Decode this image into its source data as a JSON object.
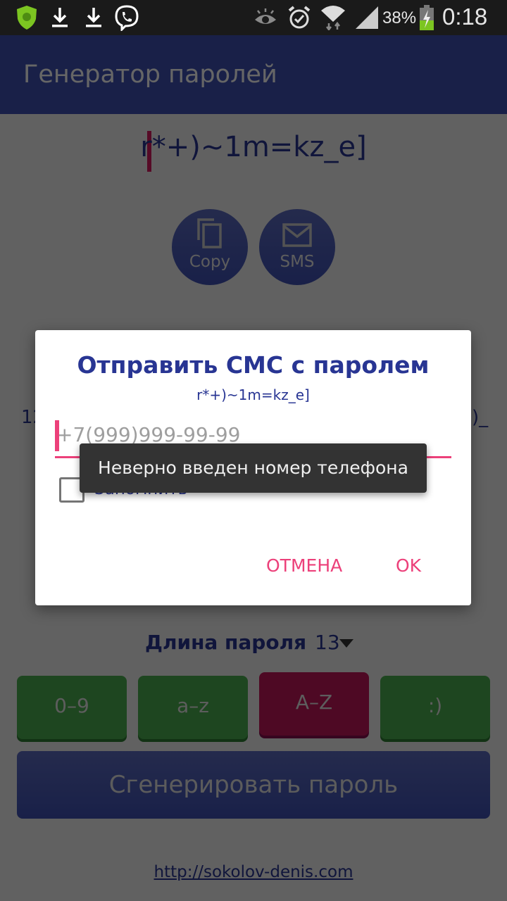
{
  "status_bar": {
    "left_icons": [
      "antivirus-shield-icon",
      "download-icon",
      "download-icon",
      "viber-icon"
    ],
    "right_icons": [
      "smart-stay-eye-icon",
      "alarm-icon",
      "wifi-icon",
      "signal-icon"
    ],
    "battery_percent": "38%",
    "battery_level": 0.38,
    "charging": true,
    "time": "0:18"
  },
  "app_bar": {
    "title": "Генератор паролей"
  },
  "main": {
    "password": "r*+)~1m=kz_e]",
    "copy_label": "Copy",
    "sms_label": "SMS",
    "bg_fragment_left": "12",
    "bg_fragment_right": ")_",
    "length_label": "Длина пароля",
    "length_value": "13",
    "charsets": [
      {
        "label": "0–9",
        "enabled": true
      },
      {
        "label": "a–z",
        "enabled": true
      },
      {
        "label": "A–Z",
        "enabled": false
      },
      {
        "label": ":)",
        "enabled": true
      }
    ],
    "generate_label": "Сгенерировать пароль",
    "footer_link": "http://sokolov-denis.com"
  },
  "dialog": {
    "title": "Отправить СМС с паролем",
    "subtitle": "r*+)~1m=kz_e]",
    "phone_value": "",
    "phone_placeholder": "+7(999)999-99-99",
    "remember_label": "Запомнить",
    "remember_checked": false,
    "cancel_label": "ОТМЕНА",
    "ok_label": "OK"
  },
  "toast": {
    "message": "Неверно введен номер телефона"
  },
  "colors": {
    "primary": "#3f51b5",
    "accent": "#ec407a",
    "enabled_green": "#4caf50",
    "disabled_red": "#c2185b"
  }
}
